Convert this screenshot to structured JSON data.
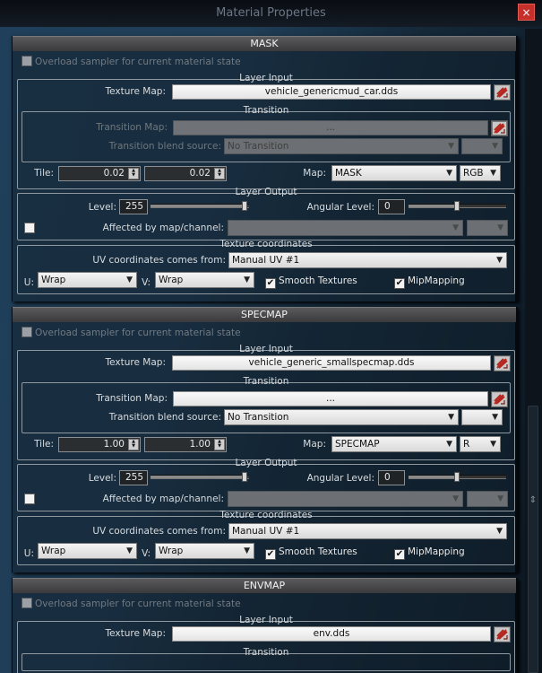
{
  "window": {
    "title": "Material Properties",
    "close_glyph": "×"
  },
  "panels": [
    {
      "header": "MASK",
      "overload_label": "Overload sampler for current material state",
      "layer_input_title": "Layer Input",
      "texture_map_label": "Texture Map:",
      "texture_map_value": "vehicle_genericmud_car.dds",
      "transition_title": "Transition",
      "transition_map_label": "Transition Map:",
      "transition_map_value": "...",
      "transition_blend_label": "Transition blend source:",
      "transition_blend_value": "No Transition",
      "transition_enabled": false,
      "tile_label": "Tile:",
      "tile_u": "0.02",
      "tile_v": "0.02",
      "map_label": "Map:",
      "map_value": "MASK",
      "channel_value": "RGB",
      "layer_output_title": "Layer Output",
      "level_label": "Level:",
      "level_value": "255",
      "level_fraction": 1.0,
      "angular_label": "Angular Level:",
      "angular_value": "0",
      "angular_fraction": 0.5,
      "affected_label": "Affected by map/channel:",
      "texcoord_title": "Texture coordinates",
      "uv_label": "UV coordinates comes from:",
      "uv_value": "Manual UV #1",
      "u_label": "U:",
      "u_value": "Wrap",
      "v_label": "V:",
      "v_value": "Wrap",
      "smooth_label": "Smooth Textures",
      "smooth_checked": true,
      "mip_label": "MipMapping",
      "mip_checked": true
    },
    {
      "header": "SPECMAP",
      "overload_label": "Overload sampler for current material state",
      "layer_input_title": "Layer Input",
      "texture_map_label": "Texture Map:",
      "texture_map_value": "vehicle_generic_smallspecmap.dds",
      "transition_title": "Transition",
      "transition_map_label": "Transition Map:",
      "transition_map_value": "...",
      "transition_blend_label": "Transition blend source:",
      "transition_blend_value": "No Transition",
      "transition_enabled": true,
      "tile_label": "Tile:",
      "tile_u": "1.00",
      "tile_v": "1.00",
      "map_label": "Map:",
      "map_value": "SPECMAP",
      "channel_value": "R",
      "layer_output_title": "Layer Output",
      "level_label": "Level:",
      "level_value": "255",
      "level_fraction": 1.0,
      "angular_label": "Angular Level:",
      "angular_value": "0",
      "angular_fraction": 0.5,
      "affected_label": "Affected by map/channel:",
      "texcoord_title": "Texture coordinates",
      "uv_label": "UV coordinates comes from:",
      "uv_value": "Manual UV #1",
      "u_label": "U:",
      "u_value": "Wrap",
      "v_label": "V:",
      "v_value": "Wrap",
      "smooth_label": "Smooth Textures",
      "smooth_checked": true,
      "mip_label": "MipMapping",
      "mip_checked": true
    },
    {
      "header": "ENVMAP",
      "overload_label": "Overload sampler for current material state",
      "layer_input_title": "Layer Input",
      "texture_map_label": "Texture Map:",
      "texture_map_value": "env.dds",
      "transition_title": "Transition"
    }
  ],
  "icons": {
    "picker": "texture-picker-icon",
    "close": "close-icon",
    "scroll_grip": "scroll-grip-icon"
  },
  "colors": {
    "close_red": "#c7302a",
    "header_gray": "#4a4a4c",
    "picker_red": "#c0302a"
  }
}
